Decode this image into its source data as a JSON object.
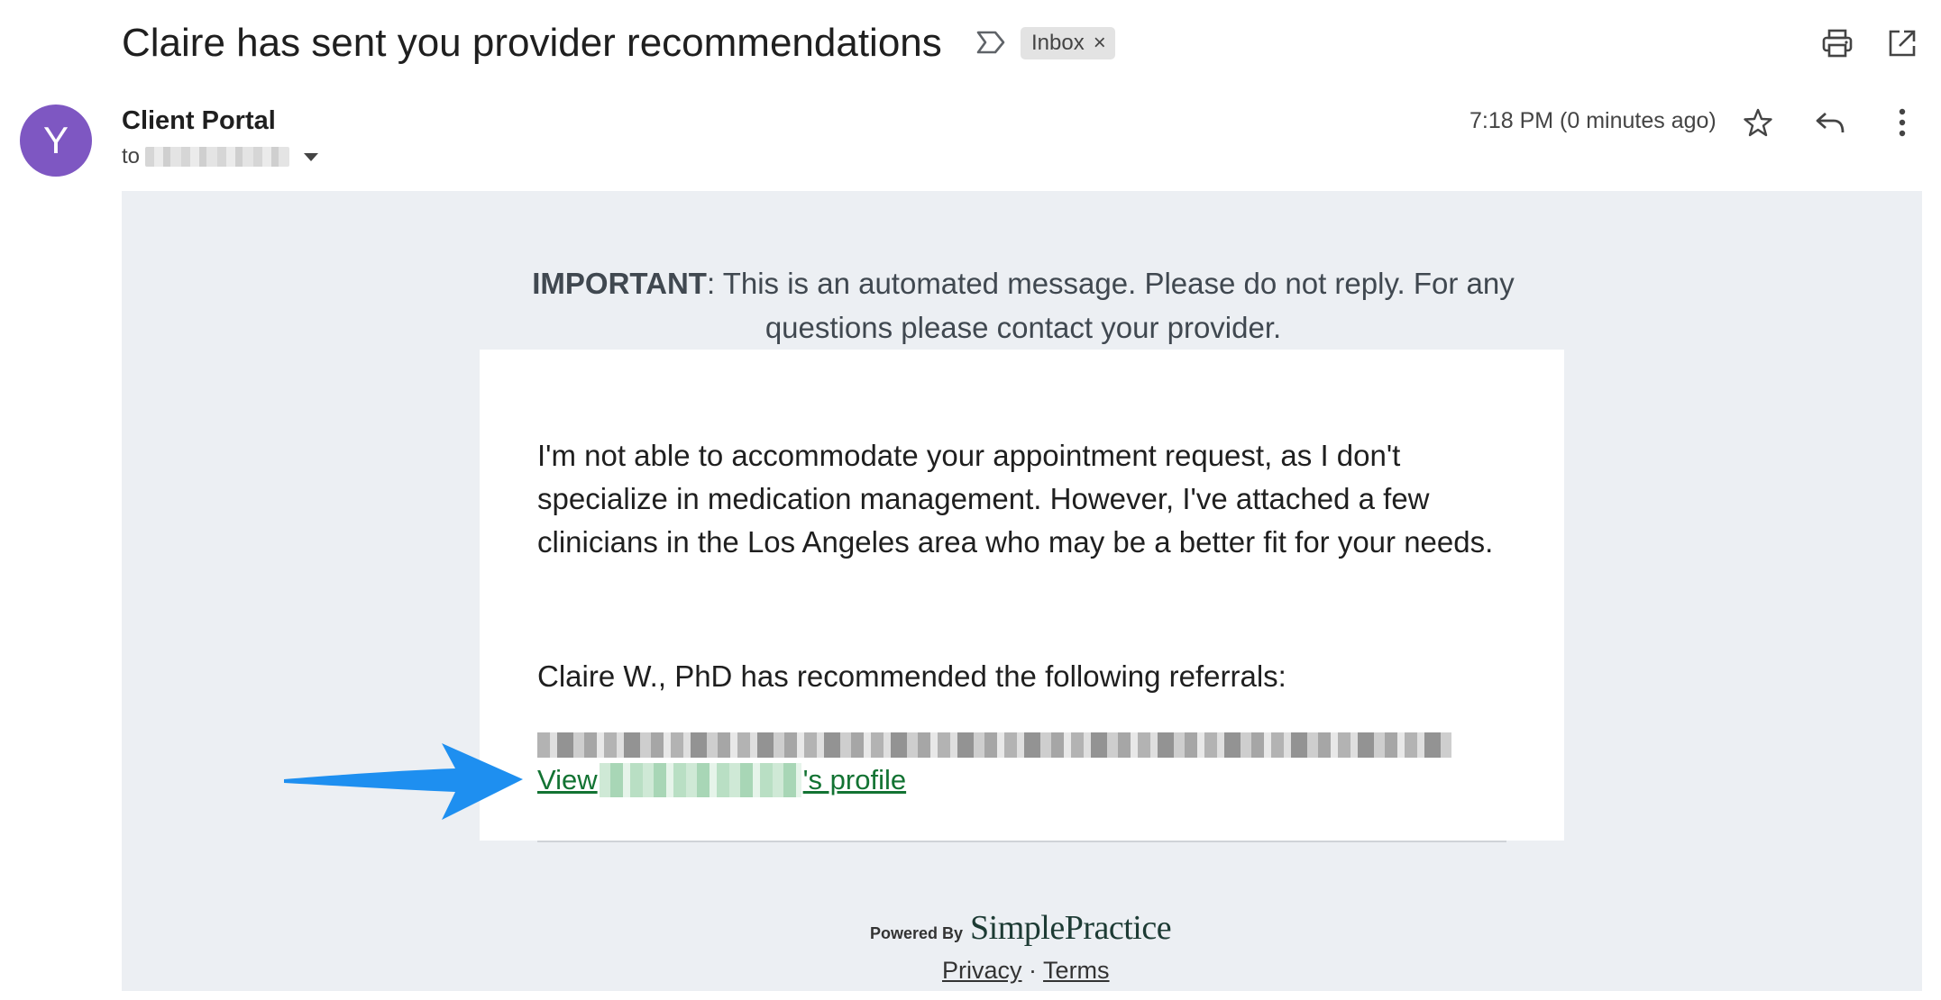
{
  "header": {
    "subject": "Claire has sent you provider recommendations",
    "inbox_chip": "Inbox",
    "chip_close": "×"
  },
  "sender": {
    "avatar_letter": "Y",
    "name": "Client Portal",
    "to_label": "to",
    "timestamp": "7:18 PM (0 minutes ago)"
  },
  "email": {
    "important_bold": "IMPORTANT",
    "important_rest": ": This is an automated message. Please do not reply. For any questions please contact your provider.",
    "message": "I'm not able to accommodate your appointment request, as I don't specialize in medication management. However, I've attached a few clinicians in the Los Angeles area who may be a better fit for your needs.",
    "recommended": "Claire W., PhD has recommended the following referrals:",
    "link_prefix": "View ",
    "link_suffix": "'s profile"
  },
  "footer": {
    "powered_by": "Powered By",
    "brand": "SimplePractice",
    "privacy": "Privacy",
    "separator": "·",
    "terms": "Terms"
  },
  "colors": {
    "avatar": "#7e57c2",
    "link": "#137333",
    "body_bg": "#eceff3",
    "annotation_arrow": "#1e8ff0"
  },
  "icons": [
    "label-icon",
    "print-icon",
    "open-in-new-icon",
    "star-icon",
    "reply-icon",
    "more-vert-icon",
    "dropdown-caret-icon"
  ]
}
